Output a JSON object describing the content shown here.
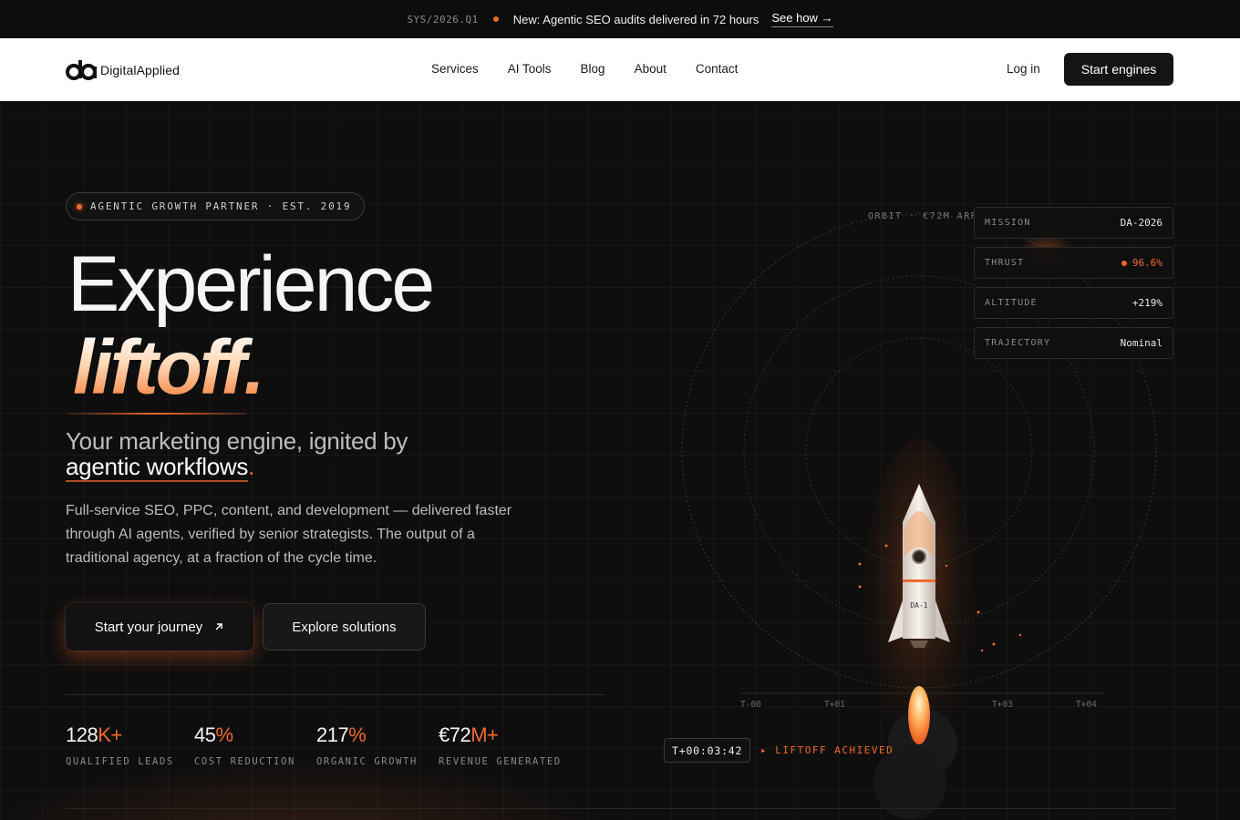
{
  "announcement": {
    "sys_code": "SYS/2026.Q1",
    "message": "New: Agentic SEO audits delivered in 72 hours",
    "link_label": "See how →"
  },
  "nav": {
    "logo_text": "DigitalApplied",
    "menu": [
      "Services",
      "AI Tools",
      "Blog",
      "About",
      "Contact"
    ],
    "login_label": "Log in",
    "cta_label": "Start engines"
  },
  "hero": {
    "badge": "AGENTIC GROWTH PARTNER · EST. 2019",
    "headline_1": "Experience",
    "headline_2": "liftoff.",
    "subhead_1": "Your marketing engine, ignited by",
    "subhead_2": "agentic workflows",
    "subhead_2_period": ".",
    "description": "Full-service SEO, PPC, content, and development — delivered faster through AI agents, verified by senior strategists. The output of a traditional agency, at a fraction of the cycle time.",
    "primary_cta": "Start your journey",
    "secondary_cta": "Explore solutions",
    "stats": [
      {
        "value": "128",
        "suffix": "K+",
        "label": "QUALIFIED LEADS"
      },
      {
        "value": "45",
        "suffix": "%",
        "label": "COST REDUCTION"
      },
      {
        "value": "217",
        "suffix": "%",
        "label": "ORGANIC GROWTH"
      },
      {
        "value": "€72",
        "suffix": "M+",
        "label": "REVENUE GENERATED"
      }
    ]
  },
  "visual": {
    "orbit_label": "ORBIT · €72M ARR",
    "telemetry": [
      {
        "key": "MISSION",
        "value": "DA-2026"
      },
      {
        "key": "THRUST",
        "value": "96.6%"
      },
      {
        "key": "ALTITUDE",
        "value": "+219%"
      },
      {
        "key": "TRAJECTORY",
        "value": "Nominal"
      }
    ],
    "rocket_label": "DA-1",
    "timeline_ticks": [
      "T-00",
      "T+01",
      "T+03",
      "T+04"
    ],
    "timer": "T+00:03:42",
    "status": "▸ LIFTOFF ACHIEVED",
    "accent_color": "#f06a2c"
  }
}
